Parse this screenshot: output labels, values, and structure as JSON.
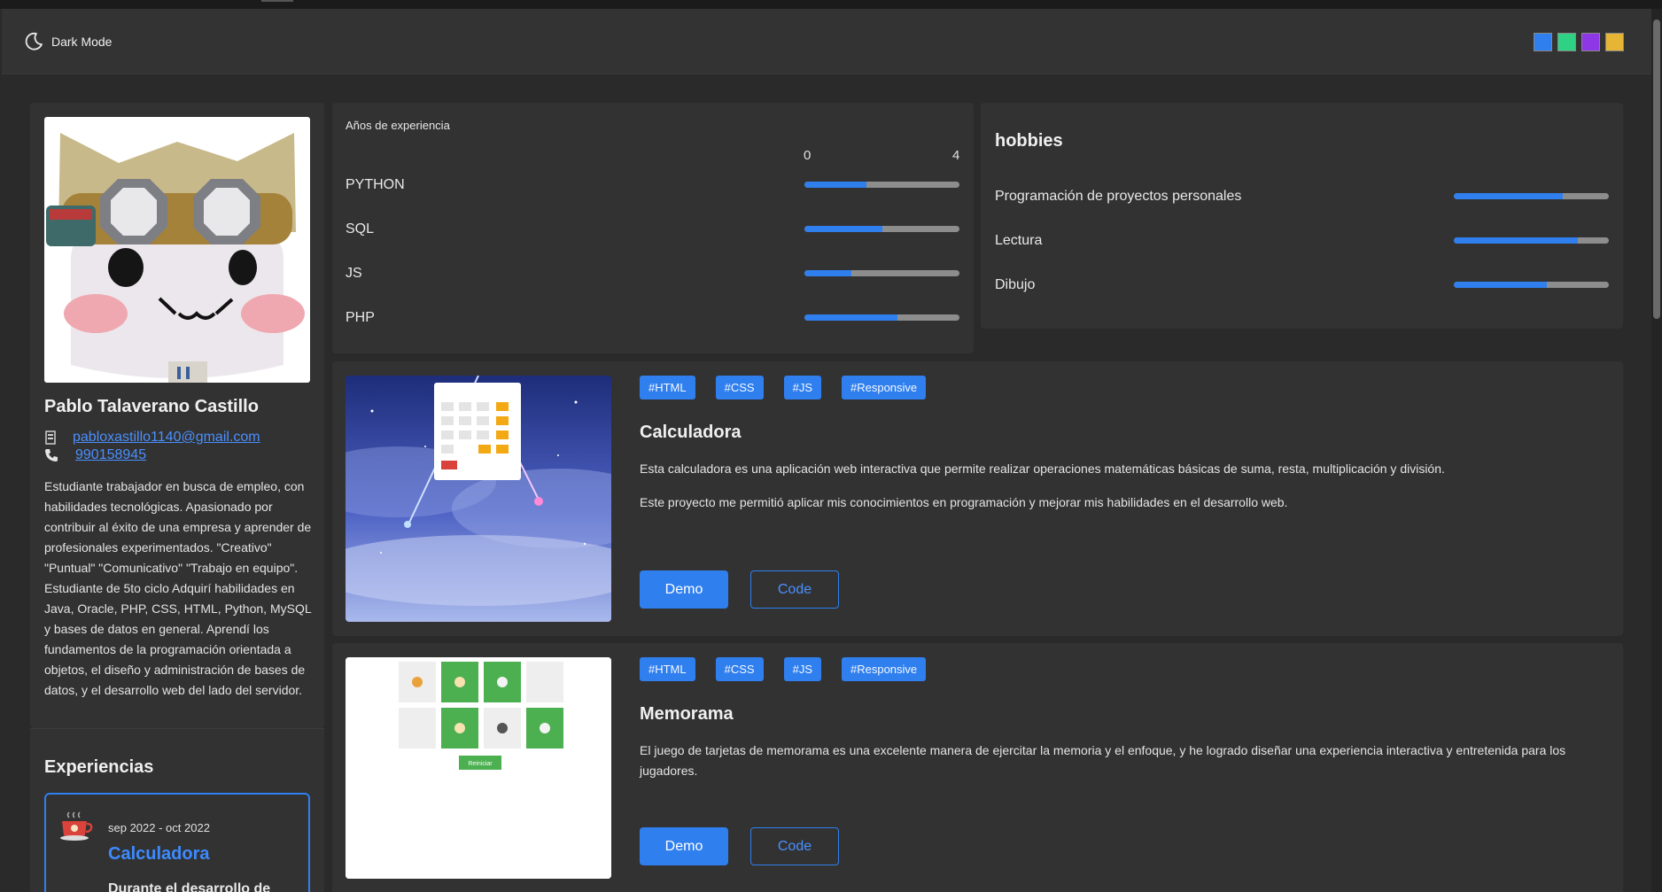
{
  "nav": {
    "dark_mode_label": "Dark Mode",
    "theme_colors": [
      "#2f7fef",
      "#2fd184",
      "#8d37e6",
      "#e6b534"
    ]
  },
  "profile": {
    "name": "Pablo Talaverano Castillo",
    "email": "pabloxastillo1140@gmail.com",
    "phone": "990158945",
    "bio": "Estudiante trabajador en busca de empleo, con habilidades tecnológicas. Apasionado por contribuir al éxito de una empresa y aprender de profesionales experimentados. \"Creativo\" \"Puntual\" \"Comunicativo\" \"Trabajo en equipo\". Estudiante de 5to ciclo Adquirí habilidades en Java, Oracle, PHP, CSS, HTML, Python, MySQL y bases de datos en general. Aprendí los fundamentos de la programación orientada a objetos, el diseño y administración de bases de datos, y el desarrollo web del lado del servidor."
  },
  "experiences": {
    "title": "Experiencias",
    "items": [
      {
        "date": "sep 2022 - oct 2022",
        "name": "Calculadora",
        "desc": "Durante el desarrollo de"
      }
    ]
  },
  "skills": {
    "title": "Años de experiencia",
    "scale_min": "0",
    "scale_max": "4",
    "items": [
      {
        "name": "PYTHON",
        "level": 0.4
      },
      {
        "name": "SQL",
        "level": 0.5
      },
      {
        "name": "JS",
        "level": 0.3
      },
      {
        "name": "PHP",
        "level": 0.6
      }
    ]
  },
  "hobbies": {
    "title": "hobbies",
    "items": [
      {
        "name": "Programación de proyectos personales",
        "level": 0.7
      },
      {
        "name": "Lectura",
        "level": 0.8
      },
      {
        "name": "Dibujo",
        "level": 0.6
      }
    ]
  },
  "projects": [
    {
      "tags": [
        "#HTML",
        "#CSS",
        "#JS",
        "#Responsive"
      ],
      "title": "Calculadora",
      "desc1": "Esta calculadora es una aplicación web interactiva que permite realizar operaciones matemáticas básicas de suma, resta, multiplicación y división.",
      "desc2": "Este proyecto me permitió aplicar mis conocimientos en programación y mejorar mis habilidades en el desarrollo web.",
      "demo_label": "Demo",
      "code_label": "Code"
    },
    {
      "tags": [
        "#HTML",
        "#CSS",
        "#JS",
        "#Responsive"
      ],
      "title": "Memorama",
      "desc1": "El juego de tarjetas de memorama es una excelente manera de ejercitar la memoria y el enfoque, y he logrado diseñar una experiencia interactiva y entretenida para los jugadores.",
      "demo_label": "Demo",
      "code_label": "Code",
      "thumb_button": "Reiniciar"
    }
  ]
}
